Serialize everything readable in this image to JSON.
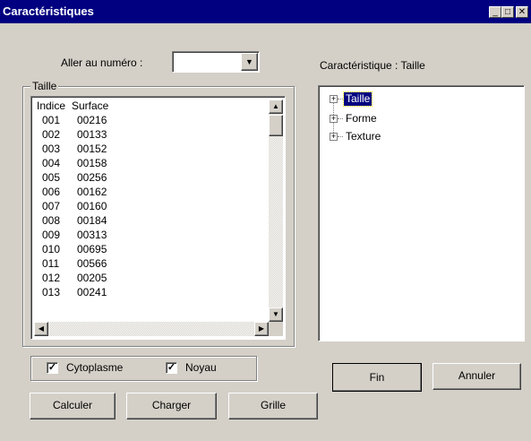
{
  "window": {
    "title": "Caractéristiques",
    "minimize_glyph": "_",
    "maximize_glyph": "□",
    "close_glyph": "✕"
  },
  "goto": {
    "label": "Aller au numéro :",
    "value": ""
  },
  "caracteristique_label": "Caractéristique : Taille",
  "group": {
    "title": "Taille",
    "headers": [
      "Indice",
      "Surface"
    ],
    "rows": [
      [
        "001",
        "00216"
      ],
      [
        "002",
        "00133"
      ],
      [
        "003",
        "00152"
      ],
      [
        "004",
        "00158"
      ],
      [
        "005",
        "00256"
      ],
      [
        "006",
        "00162"
      ],
      [
        "007",
        "00160"
      ],
      [
        "008",
        "00184"
      ],
      [
        "009",
        "00313"
      ],
      [
        "010",
        "00695"
      ],
      [
        "011",
        "00566"
      ],
      [
        "012",
        "00205"
      ],
      [
        "013",
        "00241"
      ]
    ]
  },
  "tree": {
    "items": [
      {
        "label": "Taille",
        "selected": true
      },
      {
        "label": "Forme",
        "selected": false
      },
      {
        "label": "Texture",
        "selected": false
      }
    ]
  },
  "checkboxes": [
    {
      "label": "Cytoplasme",
      "checked": true
    },
    {
      "label": "Noyau",
      "checked": true
    }
  ],
  "buttons": {
    "calculer": "Calculer",
    "charger": "Charger",
    "grille": "Grille",
    "fin": "Fin",
    "annuler": "Annuler"
  }
}
